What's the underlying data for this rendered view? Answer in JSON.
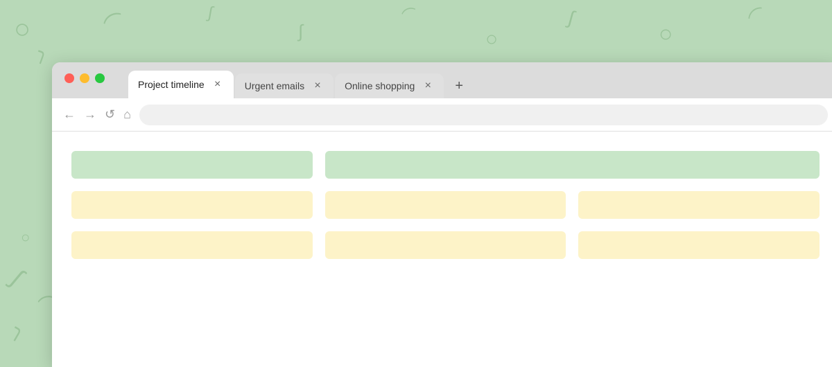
{
  "background": {
    "color": "#b8d9b8"
  },
  "browser": {
    "traffic_lights": {
      "red": "#ff5f57",
      "yellow": "#febc2e",
      "green": "#28c840"
    },
    "tabs": [
      {
        "id": "project-timeline",
        "label": "Project timeline",
        "active": true
      },
      {
        "id": "urgent-emails",
        "label": "Urgent emails",
        "active": false
      },
      {
        "id": "online-shopping",
        "label": "Online shopping",
        "active": false
      }
    ],
    "add_tab_label": "+",
    "nav": {
      "back": "←",
      "forward": "→",
      "reload": "↺",
      "home": "⌂"
    }
  },
  "content": {
    "rows": [
      {
        "type": "green",
        "cols": [
          1,
          2
        ]
      },
      {
        "type": "yellow",
        "cols": [
          1,
          1,
          1
        ]
      },
      {
        "type": "yellow",
        "cols": [
          1,
          1,
          1
        ]
      }
    ]
  }
}
